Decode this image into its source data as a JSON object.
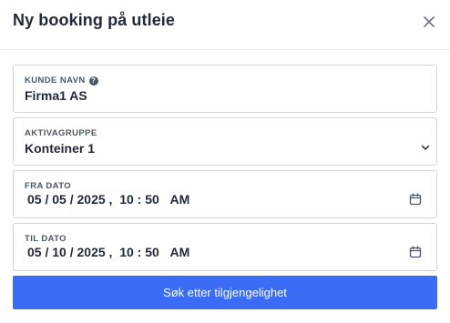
{
  "modal": {
    "title": "Ny booking på utleie"
  },
  "fields": {
    "customer": {
      "label": "KUNDE NAVN",
      "value": "Firma1 AS"
    },
    "asset_group": {
      "label": "AKTIVAGRUPPE",
      "value": "Konteiner 1"
    },
    "from_date": {
      "label": "FRA DATO",
      "month": "05",
      "day": "05",
      "year": "2025",
      "hour": "10",
      "minute": "50",
      "ampm": "AM"
    },
    "to_date": {
      "label": "TIL DATO",
      "month": "05",
      "day": "10",
      "year": "2025",
      "hour": "10",
      "minute": "50",
      "ampm": "AM"
    }
  },
  "actions": {
    "search_label": "Søk etter tilgjengelighet"
  },
  "icons": {
    "close": "close-icon",
    "help": "help-icon",
    "chevron": "chevron-down-icon",
    "calendar": "calendar-icon"
  },
  "colors": {
    "primary": "#3b6cf6"
  }
}
